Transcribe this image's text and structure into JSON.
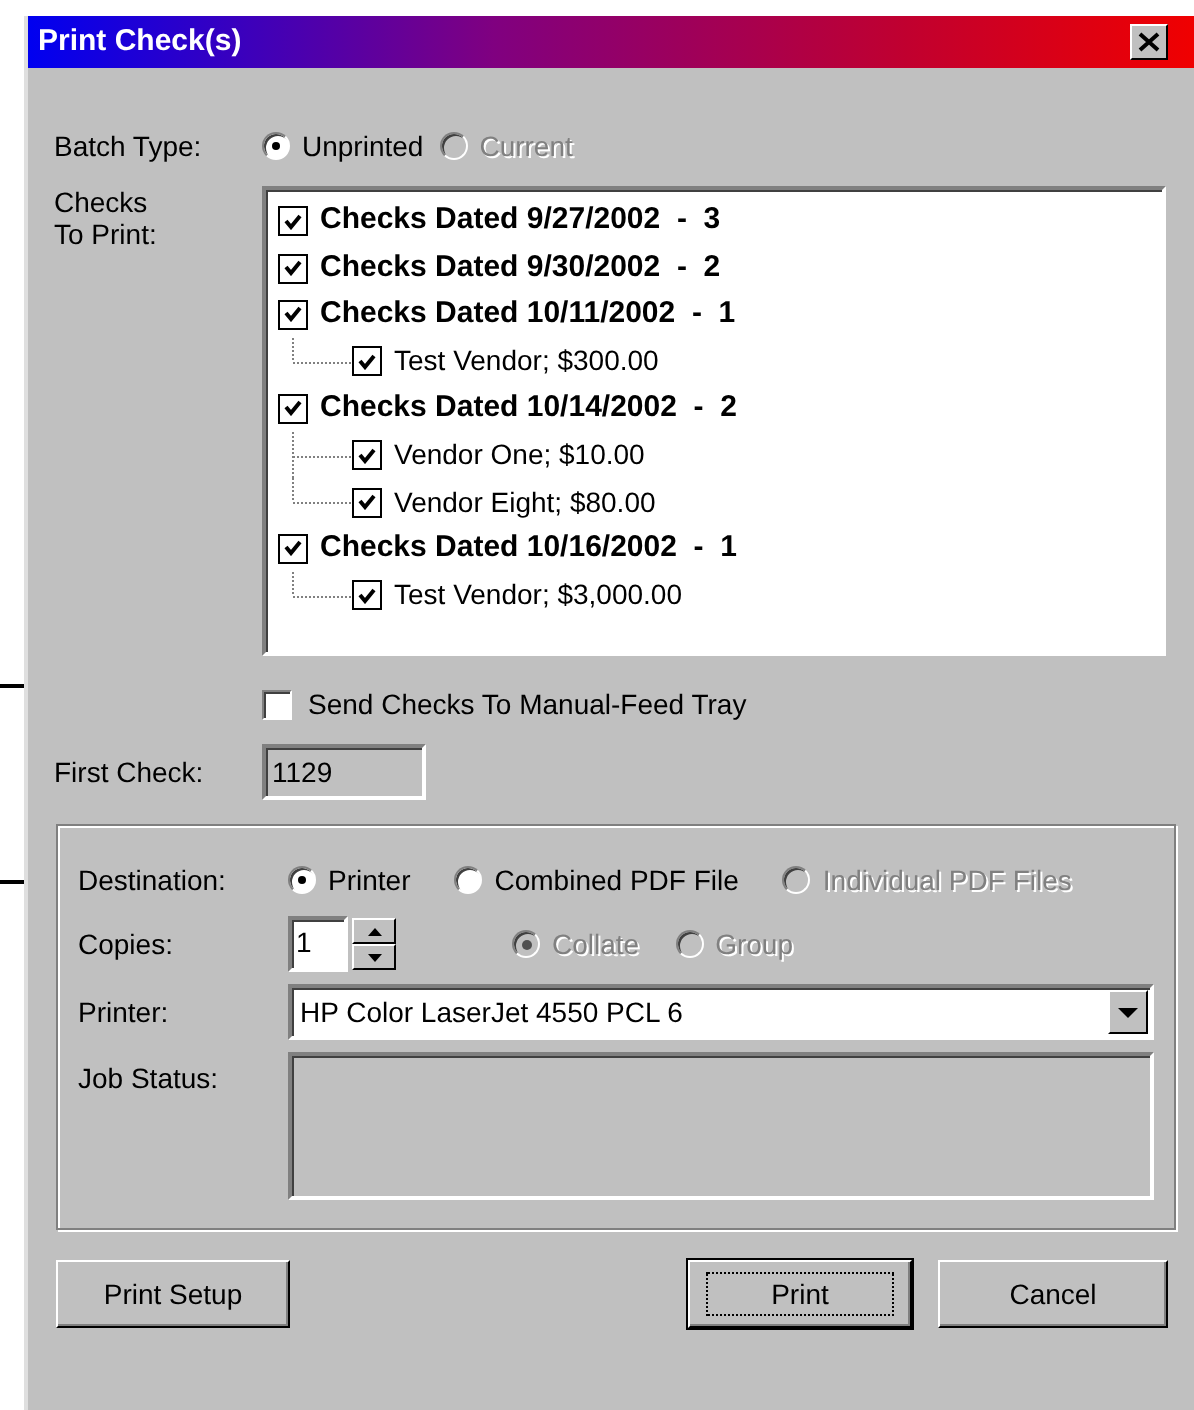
{
  "window": {
    "title": "Print Check(s)"
  },
  "batch_type": {
    "label": "Batch Type:",
    "options": [
      {
        "label": "Unprinted",
        "selected": true,
        "disabled": false
      },
      {
        "label": "Current",
        "selected": false,
        "disabled": true
      }
    ]
  },
  "checks_to_print": {
    "label": "Checks To Print:",
    "tree": [
      {
        "label": "Checks Dated 9/27/2002  -  3",
        "checked": true
      },
      {
        "label": "Checks Dated 9/30/2002  -  2",
        "checked": true
      },
      {
        "label": "Checks Dated 10/11/2002  -  1",
        "checked": true,
        "children": [
          {
            "label": "Test Vendor; $300.00",
            "checked": true
          }
        ]
      },
      {
        "label": "Checks Dated 10/14/2002  -  2",
        "checked": true,
        "children": [
          {
            "label": "Vendor One; $10.00",
            "checked": true
          },
          {
            "label": "Vendor Eight; $80.00",
            "checked": true
          }
        ]
      },
      {
        "label": "Checks Dated 10/16/2002  -  1",
        "checked": true,
        "children": [
          {
            "label": "Test Vendor; $3,000.00",
            "checked": true
          }
        ]
      }
    ]
  },
  "manual_feed": {
    "label": "Send Checks To Manual-Feed Tray",
    "checked": false
  },
  "first_check": {
    "label": "First Check:",
    "value": "1129"
  },
  "destination": {
    "label": "Destination:",
    "options": [
      {
        "label": "Printer",
        "selected": true,
        "disabled": false
      },
      {
        "label": "Combined PDF File",
        "selected": false,
        "disabled": false
      },
      {
        "label": "Individual PDF Files",
        "selected": false,
        "disabled": true
      }
    ]
  },
  "copies": {
    "label": "Copies:",
    "value": "1",
    "collation": [
      {
        "label": "Collate",
        "selected": true,
        "disabled": true
      },
      {
        "label": "Group",
        "selected": false,
        "disabled": true
      }
    ]
  },
  "printer": {
    "label": "Printer:",
    "value": "HP Color LaserJet 4550 PCL 6"
  },
  "job_status": {
    "label": "Job Status:"
  },
  "buttons": [
    {
      "label": "Print Setup",
      "default": false
    },
    {
      "label": "Print",
      "default": true
    },
    {
      "label": "Cancel",
      "default": false
    }
  ]
}
